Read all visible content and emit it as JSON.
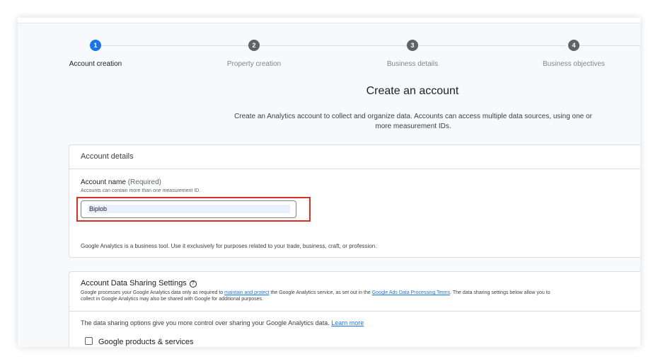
{
  "stepper": {
    "steps": [
      {
        "number": "1",
        "label": "Account creation"
      },
      {
        "number": "2",
        "label": "Property creation"
      },
      {
        "number": "3",
        "label": "Business details"
      },
      {
        "number": "4",
        "label": "Business objectives"
      }
    ],
    "active_step": 1
  },
  "header": {
    "title": "Create an account",
    "description": "Create an Analytics account to collect and organize data. Accounts can access multiple data sources, using one or more measurement IDs."
  },
  "account_details": {
    "section_title": "Account details",
    "field_label": "Account name",
    "field_required": "(Required)",
    "field_hint": "Accounts can contain more than one measurement ID.",
    "field_value": "Biplob",
    "note": "Google Analytics is a business tool. Use it exclusively for purposes related to your trade, business, craft, or profession."
  },
  "data_sharing": {
    "title": "Account Data Sharing Settings",
    "help_icon": "?",
    "text_1": "Google processes your Google Analytics data only as required to",
    "link_1": "maintain and protect",
    "text_2": "the Google Analytics service, as set out in the",
    "link_2": "Google Ads Data Processing Terms",
    "text_3": ". The data sharing settings below allow you to",
    "text_4": "collect in Google Analytics may also be shared with Google for additional purposes.",
    "intro": "The data sharing options give you more control over sharing your Google Analytics data.",
    "learn_more": "Learn more",
    "option_1": "Google products & services"
  },
  "colors": {
    "accent": "#1a73e8",
    "highlight_border": "#d93025",
    "input_fill": "#e8f0fe"
  }
}
